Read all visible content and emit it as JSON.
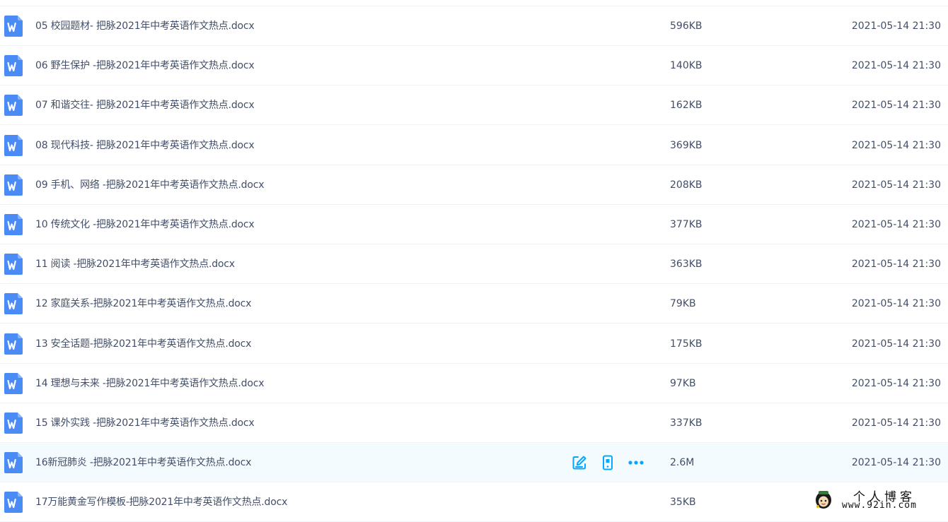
{
  "files": [
    {
      "name": "05 校园题材- 把脉2021年中考英语作文热点.docx",
      "size": "596KB",
      "time": "2021-05-14 21:30"
    },
    {
      "name": "06 野生保护 -把脉2021年中考英语作文热点.docx",
      "size": "140KB",
      "time": "2021-05-14 21:30"
    },
    {
      "name": "07 和谐交往- 把脉2021年中考英语作文热点.docx",
      "size": "162KB",
      "time": "2021-05-14 21:30"
    },
    {
      "name": "08 现代科技- 把脉2021年中考英语作文热点.docx",
      "size": "369KB",
      "time": "2021-05-14 21:30"
    },
    {
      "name": "09 手机、网络 -把脉2021年中考英语作文热点.docx",
      "size": "208KB",
      "time": "2021-05-14 21:30"
    },
    {
      "name": "10 传统文化 -把脉2021年中考英语作文热点.docx",
      "size": "377KB",
      "time": "2021-05-14 21:30"
    },
    {
      "name": "11 阅读 -把脉2021年中考英语作文热点.docx",
      "size": "363KB",
      "time": "2021-05-14 21:30"
    },
    {
      "name": "12 家庭关系-把脉2021年中考英语作文热点.docx",
      "size": "79KB",
      "time": "2021-05-14 21:30"
    },
    {
      "name": "13 安全话题-把脉2021年中考英语作文热点.docx",
      "size": "175KB",
      "time": "2021-05-14 21:30"
    },
    {
      "name": "14 理想与未来 -把脉2021年中考英语作文热点.docx",
      "size": "97KB",
      "time": "2021-05-14 21:30"
    },
    {
      "name": "15 课外实践 -把脉2021年中考英语作文热点.docx",
      "size": "337KB",
      "time": "2021-05-14 21:30"
    },
    {
      "name": "16新冠肺炎 -把脉2021年中考英语作文热点.docx",
      "size": "2.6M",
      "time": "2021-05-14 21:30"
    },
    {
      "name": "17万能黄金写作模板-把脉2021年中考英语作文热点.docx",
      "size": "35KB",
      "time": ""
    }
  ],
  "hovered_row": 11,
  "icons": {
    "file": "word-doc-icon",
    "edit": "edit-icon",
    "phone": "send-to-phone-icon",
    "more": "more-icon"
  },
  "colors": {
    "word_blue": "#4a8bf5",
    "action_blue": "#06a7ff",
    "hover_bg": "#f4fbff",
    "text": "#424e67"
  },
  "watermark": {
    "title": "个人博客",
    "url": "www.92in.com"
  }
}
